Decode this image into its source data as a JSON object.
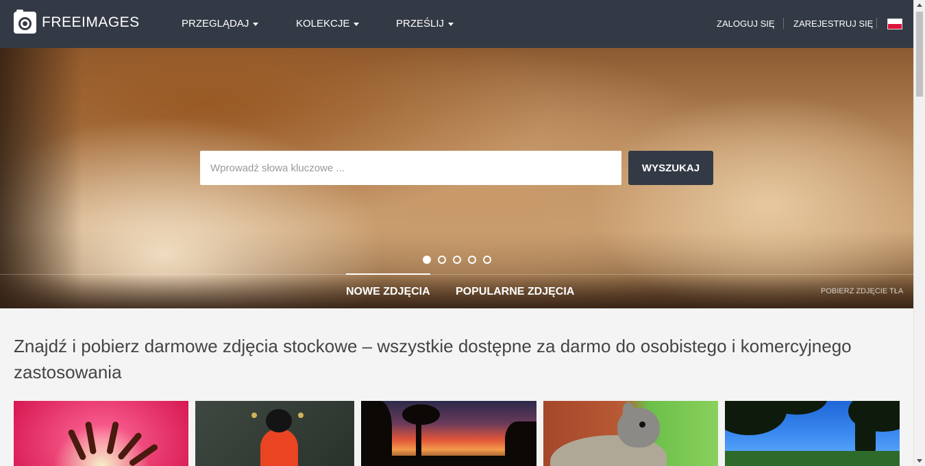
{
  "navbar": {
    "logo_text": "FREEIMAGES",
    "menu": [
      {
        "label": "PRZEGLĄDAJ"
      },
      {
        "label": "KOLEKCJE"
      },
      {
        "label": "PRZEŚLIJ"
      }
    ],
    "login_label": "ZALOGUJ SIĘ",
    "register_label": "ZAREJESTRUJ SIĘ",
    "language_flag": "flag-poland-icon"
  },
  "hero": {
    "search_placeholder": "Wprowadź słowa kluczowe ...",
    "search_value": "",
    "search_button": "WYSZUKAJ",
    "slider_dots": 5,
    "active_dot": 1,
    "tabs": [
      {
        "label": "NOWE ZDJĘCIA",
        "active": true
      },
      {
        "label": "POPULARNE ZDJĘCIA",
        "active": false
      }
    ],
    "background_download": "POBIERZ ZDJĘCIE TŁA"
  },
  "main": {
    "headline": "Znajdź i pobierz darmowe zdjęcia stockowe – wszystkie dostępne za darmo do osobistego i komercyjnego zastosowania",
    "thumbnails": [
      {
        "name": "tulip-closeup-thumbnail"
      },
      {
        "name": "black-swan-thumbnail"
      },
      {
        "name": "sunset-trees-thumbnail"
      },
      {
        "name": "squirrel-thumbnail"
      },
      {
        "name": "blue-sky-trees-thumbnail"
      }
    ]
  },
  "colors": {
    "navbar_bg": "#343a45",
    "search_button_bg": "#343a45",
    "page_bg": "#f4f4f4"
  }
}
